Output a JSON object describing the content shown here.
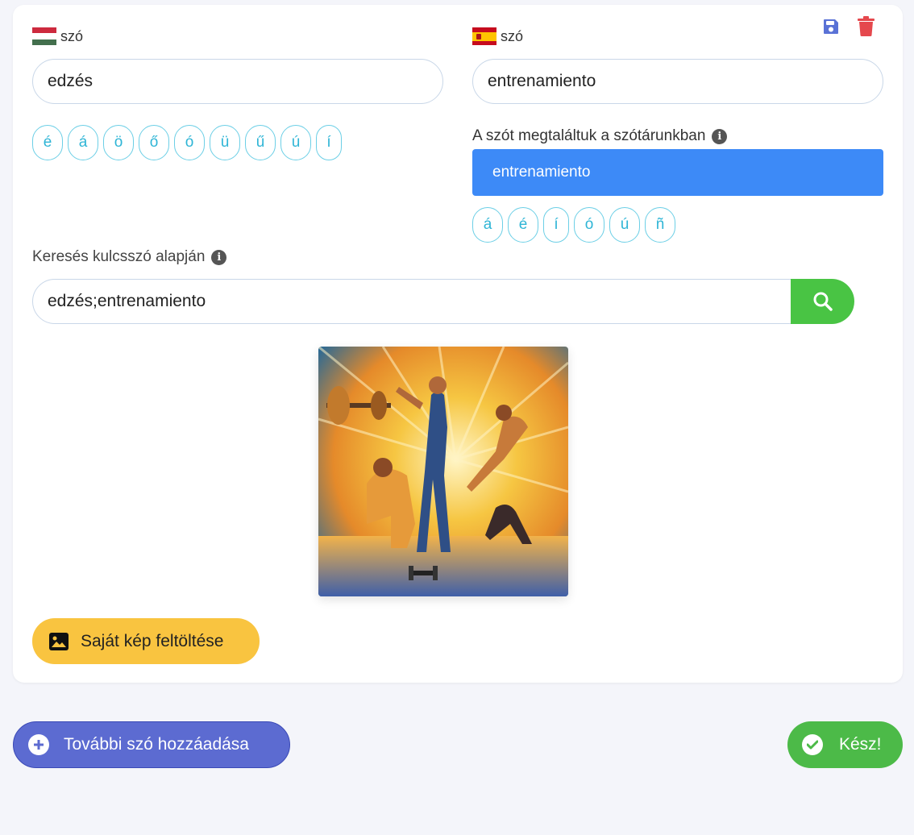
{
  "hungarian": {
    "label": "szó",
    "value": "edzés",
    "chips": [
      "é",
      "á",
      "ö",
      "ő",
      "ó",
      "ü",
      "ű",
      "ú",
      "í"
    ]
  },
  "spanish": {
    "label": "szó",
    "value": "entrenamiento",
    "dictionary_label": "A szót megtaláltuk a szótárunkban",
    "dictionary_result": "entrenamiento",
    "chips": [
      "á",
      "é",
      "í",
      "ó",
      "ú",
      "ñ"
    ]
  },
  "search": {
    "label": "Keresés kulcsszó alapján",
    "value": "edzés;entrenamiento"
  },
  "buttons": {
    "upload": "Saját kép feltöltése",
    "add_word": "További szó hozzáadása",
    "done": "Kész!"
  },
  "colors": {
    "primary": "#3d8af7",
    "success": "#4cba48",
    "warning": "#f9c440",
    "indigo": "#5c6bd1",
    "danger": "#e5484d"
  },
  "icons": {
    "save": "floppy-disk-icon",
    "delete": "trash-icon",
    "info": "info-icon",
    "search": "search-icon",
    "upload": "image-icon",
    "add": "plus-circle-icon",
    "done": "check-circle-icon"
  }
}
